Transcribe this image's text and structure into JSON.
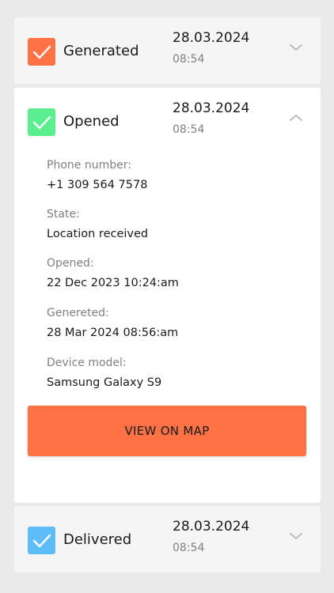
{
  "colors": {
    "generated": "#ff7246",
    "opened": "#5bef8f",
    "delivered": "#5ebdf8",
    "button": "#ff7246"
  },
  "cards": {
    "generated": {
      "label": "Generated",
      "date": "28.03.2024",
      "time": "08:54",
      "icon": "chevron-down-icon"
    },
    "opened": {
      "label": "Opened",
      "date": "28.03.2024",
      "time": "08:54",
      "icon": "chevron-up-icon",
      "fields": [
        {
          "label": "Phone number:",
          "value": "+1 309 564 7578"
        },
        {
          "label": "State:",
          "value": "Location received"
        },
        {
          "label": "Opened:",
          "value": "22 Dec 2023 10:24:am"
        },
        {
          "label": "Genereted:",
          "value": "28 Mar 2024 08:56:am"
        },
        {
          "label": "Device model:",
          "value": "Samsung Galaxy S9"
        }
      ],
      "button_label": "VIEW ON MAP"
    },
    "delivered": {
      "label": "Delivered",
      "date": "28.03.2024",
      "time": "08:54",
      "icon": "chevron-down-icon"
    }
  }
}
